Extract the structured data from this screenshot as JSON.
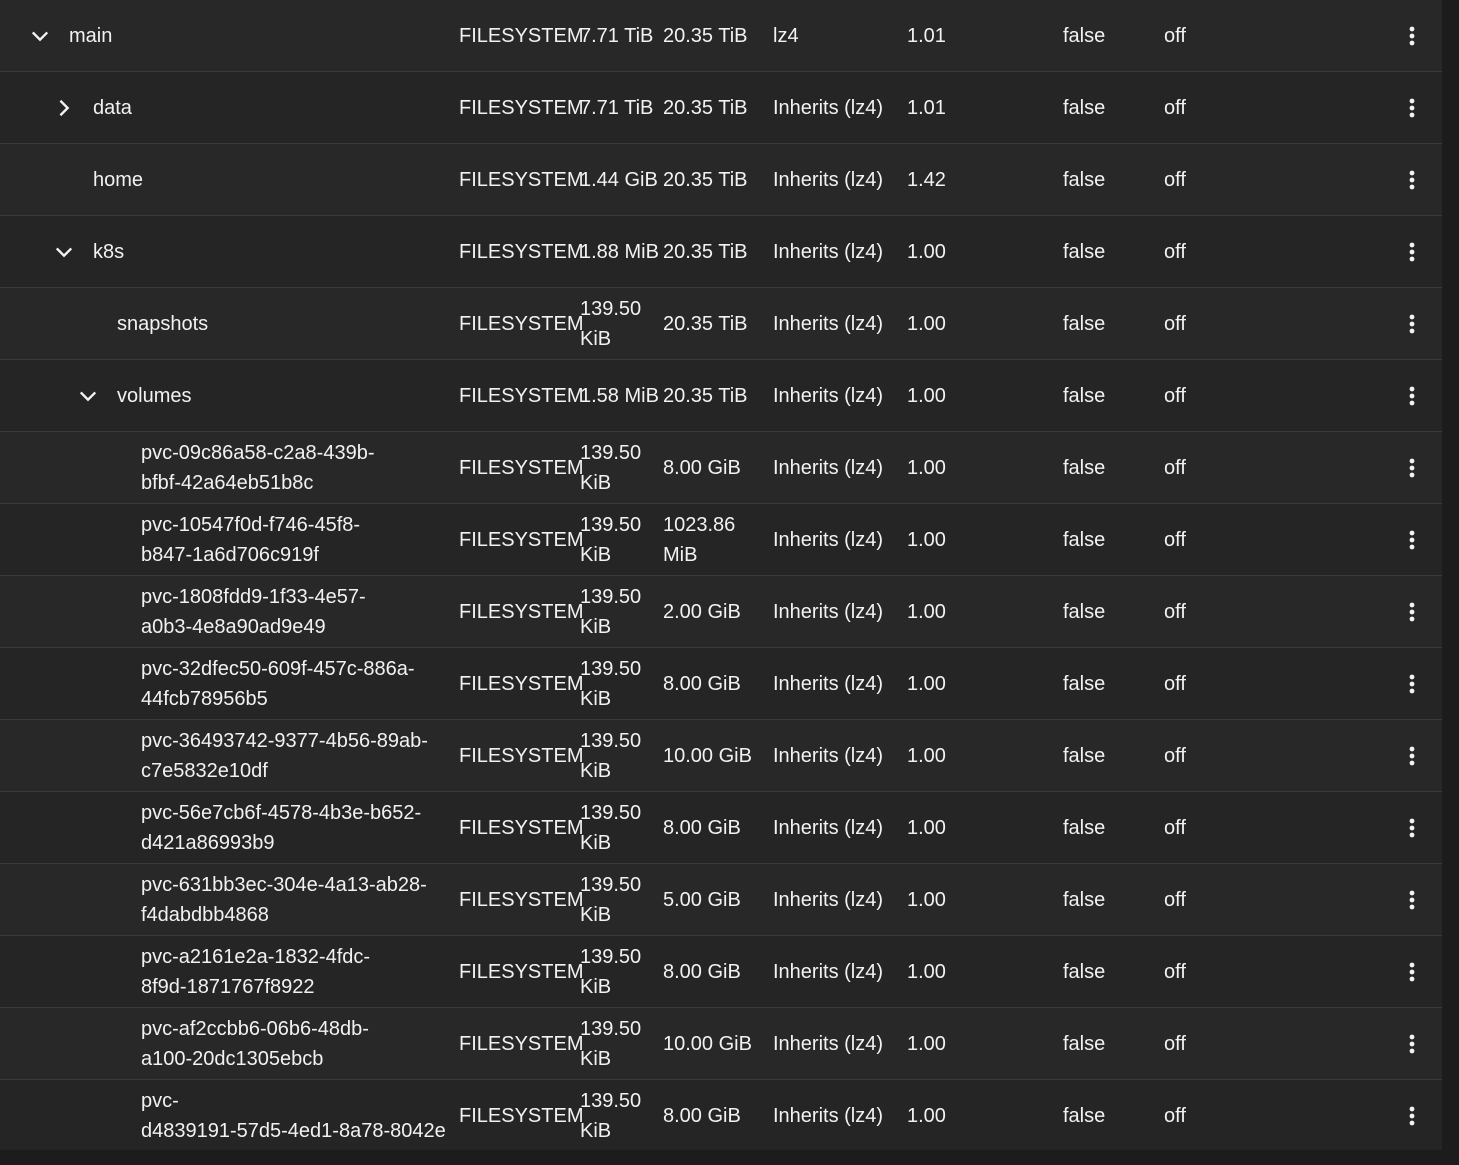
{
  "rows": [
    {
      "name": "main",
      "type": "FILESYSTEM",
      "used": "7.71 TiB",
      "available": "20.35 TiB",
      "compression": "lz4",
      "ratio": "1.01",
      "readonly": "false",
      "dedup": "off"
    },
    {
      "name": "data",
      "type": "FILESYSTEM",
      "used": "7.71 TiB",
      "available": "20.35 TiB",
      "compression": "Inherits (lz4)",
      "ratio": "1.01",
      "readonly": "false",
      "dedup": "off"
    },
    {
      "name": "home",
      "type": "FILESYSTEM",
      "used": "1.44 GiB",
      "available": "20.35 TiB",
      "compression": "Inherits (lz4)",
      "ratio": "1.42",
      "readonly": "false",
      "dedup": "off"
    },
    {
      "name": "k8s",
      "type": "FILESYSTEM",
      "used": "1.88 MiB",
      "available": "20.35 TiB",
      "compression": "Inherits (lz4)",
      "ratio": "1.00",
      "readonly": "false",
      "dedup": "off"
    },
    {
      "name": "snapshots",
      "type": "FILESYSTEM",
      "used": "139.50 KiB",
      "available": "20.35 TiB",
      "compression": "Inherits (lz4)",
      "ratio": "1.00",
      "readonly": "false",
      "dedup": "off"
    },
    {
      "name": "volumes",
      "type": "FILESYSTEM",
      "used": "1.58 MiB",
      "available": "20.35 TiB",
      "compression": "Inherits (lz4)",
      "ratio": "1.00",
      "readonly": "false",
      "dedup": "off"
    },
    {
      "name": "pvc-09c86a58-c2a8-439b-bfbf-42a64eb51b8c",
      "type": "FILESYSTEM",
      "used": "139.50 KiB",
      "available": "8.00 GiB",
      "compression": "Inherits (lz4)",
      "ratio": "1.00",
      "readonly": "false",
      "dedup": "off"
    },
    {
      "name": "pvc-10547f0d-f746-45f8-b847-1a6d706c919f",
      "type": "FILESYSTEM",
      "used": "139.50 KiB",
      "available": "1023.86 MiB",
      "compression": "Inherits (lz4)",
      "ratio": "1.00",
      "readonly": "false",
      "dedup": "off"
    },
    {
      "name": "pvc-1808fdd9-1f33-4e57-a0b3-4e8a90ad9e49",
      "type": "FILESYSTEM",
      "used": "139.50 KiB",
      "available": "2.00 GiB",
      "compression": "Inherits (lz4)",
      "ratio": "1.00",
      "readonly": "false",
      "dedup": "off"
    },
    {
      "name": "pvc-32dfec50-609f-457c-886a-44fcb78956b5",
      "type": "FILESYSTEM",
      "used": "139.50 KiB",
      "available": "8.00 GiB",
      "compression": "Inherits (lz4)",
      "ratio": "1.00",
      "readonly": "false",
      "dedup": "off"
    },
    {
      "name": "pvc-36493742-9377-4b56-89ab-c7e5832e10df",
      "type": "FILESYSTEM",
      "used": "139.50 KiB",
      "available": "10.00 GiB",
      "compression": "Inherits (lz4)",
      "ratio": "1.00",
      "readonly": "false",
      "dedup": "off"
    },
    {
      "name": "pvc-56e7cb6f-4578-4b3e-b652-d421a86993b9",
      "type": "FILESYSTEM",
      "used": "139.50 KiB",
      "available": "8.00 GiB",
      "compression": "Inherits (lz4)",
      "ratio": "1.00",
      "readonly": "false",
      "dedup": "off"
    },
    {
      "name": "pvc-631bb3ec-304e-4a13-ab28-f4dabdbb4868",
      "type": "FILESYSTEM",
      "used": "139.50 KiB",
      "available": "5.00 GiB",
      "compression": "Inherits (lz4)",
      "ratio": "1.00",
      "readonly": "false",
      "dedup": "off"
    },
    {
      "name": "pvc-a2161e2a-1832-4fdc-8f9d-1871767f8922",
      "type": "FILESYSTEM",
      "used": "139.50 KiB",
      "available": "8.00 GiB",
      "compression": "Inherits (lz4)",
      "ratio": "1.00",
      "readonly": "false",
      "dedup": "off"
    },
    {
      "name": "pvc-af2ccbb6-06b6-48db-a100-20dc1305ebcb",
      "type": "FILESYSTEM",
      "used": "139.50 KiB",
      "available": "10.00 GiB",
      "compression": "Inherits (lz4)",
      "ratio": "1.00",
      "readonly": "false",
      "dedup": "off"
    },
    {
      "name": "pvc-d4839191-57d5-4ed1-8a78-8042e",
      "type": "FILESYSTEM",
      "used": "139.50 KiB",
      "available": "8.00 GiB",
      "compression": "Inherits (lz4)",
      "ratio": "1.00",
      "readonly": "false",
      "dedup": "off"
    }
  ],
  "icons": {
    "expanded": "chevron-down-icon",
    "collapsed": "chevron-right-icon",
    "menu": "more-vertical-icon"
  },
  "colors": {
    "background": "#282828",
    "text": "#f2f2f2",
    "divider": "#3a3a3a"
  }
}
